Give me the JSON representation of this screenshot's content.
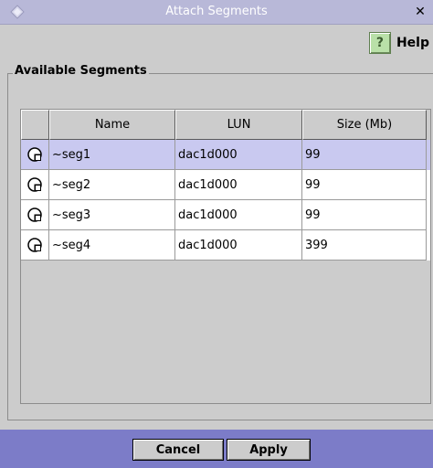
{
  "window": {
    "title": "Attach Segments",
    "close_glyph": "✕"
  },
  "toolbar": {
    "help_label": "Help",
    "help_icon_glyph": "?"
  },
  "group": {
    "title": "Available Segments"
  },
  "table": {
    "columns": [
      "",
      "Name",
      "LUN",
      "Size (Mb)"
    ],
    "rows": [
      {
        "name": "~seg1",
        "lun": "dac1d000",
        "size": "99",
        "selected": true
      },
      {
        "name": "~seg2",
        "lun": "dac1d000",
        "size": "99",
        "selected": false
      },
      {
        "name": "~seg3",
        "lun": "dac1d000",
        "size": "99",
        "selected": false
      },
      {
        "name": "~seg4",
        "lun": "dac1d000",
        "size": "399",
        "selected": false
      }
    ]
  },
  "buttons": {
    "cancel": "Cancel",
    "apply": "Apply"
  },
  "colors": {
    "titlebar": "#b8b8d8",
    "selection": "#c9c9f0",
    "bottom_bar": "#7c7cc8",
    "background": "#cccccc"
  }
}
